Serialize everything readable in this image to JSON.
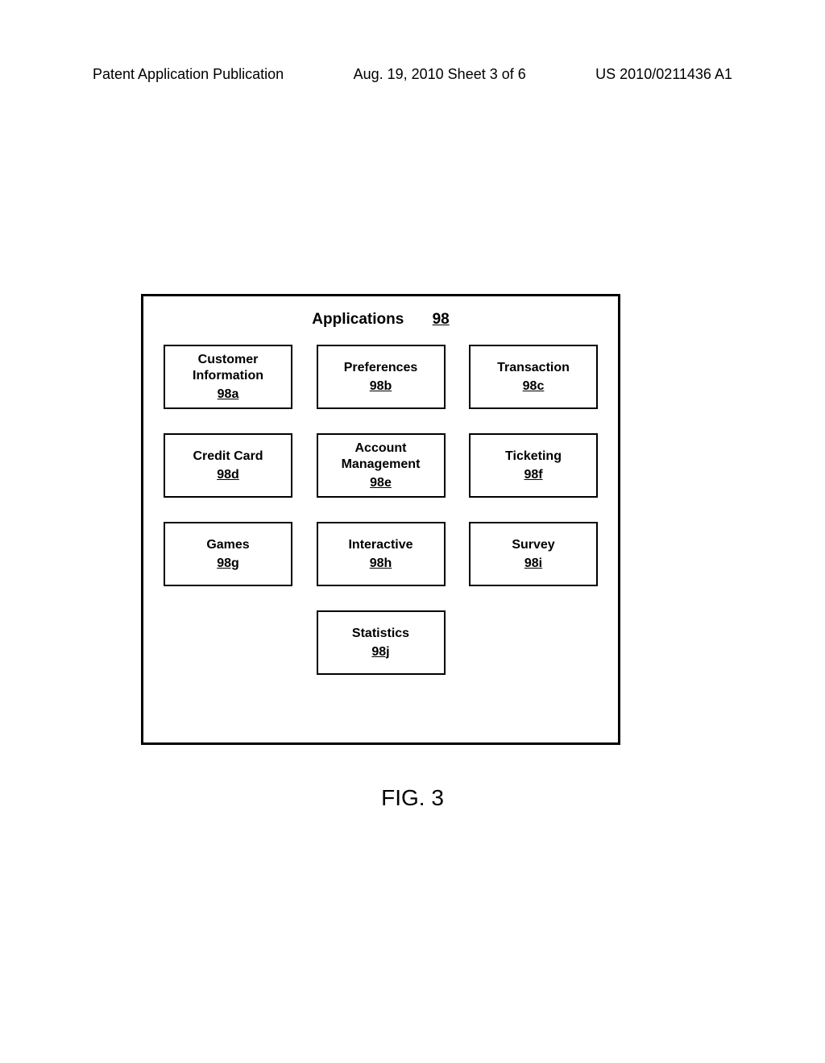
{
  "header": {
    "left": "Patent Application Publication",
    "center": "Aug. 19, 2010  Sheet 3 of 6",
    "right": "US 2010/0211436 A1"
  },
  "container": {
    "title": "Applications",
    "ref": "98"
  },
  "boxes": {
    "a": {
      "label": "Customer Information",
      "ref": "98a"
    },
    "b": {
      "label": "Preferences",
      "ref": "98b"
    },
    "c": {
      "label": "Transaction",
      "ref": "98c"
    },
    "d": {
      "label": "Credit Card",
      "ref": "98d"
    },
    "e": {
      "label": "Account Management",
      "ref": "98e"
    },
    "f": {
      "label": "Ticketing",
      "ref": "98f"
    },
    "g": {
      "label": "Games",
      "ref": "98g"
    },
    "h": {
      "label": "Interactive",
      "ref": "98h"
    },
    "i": {
      "label": "Survey",
      "ref": "98i"
    },
    "j": {
      "label": "Statistics",
      "ref": "98j"
    }
  },
  "caption": "FIG. 3"
}
